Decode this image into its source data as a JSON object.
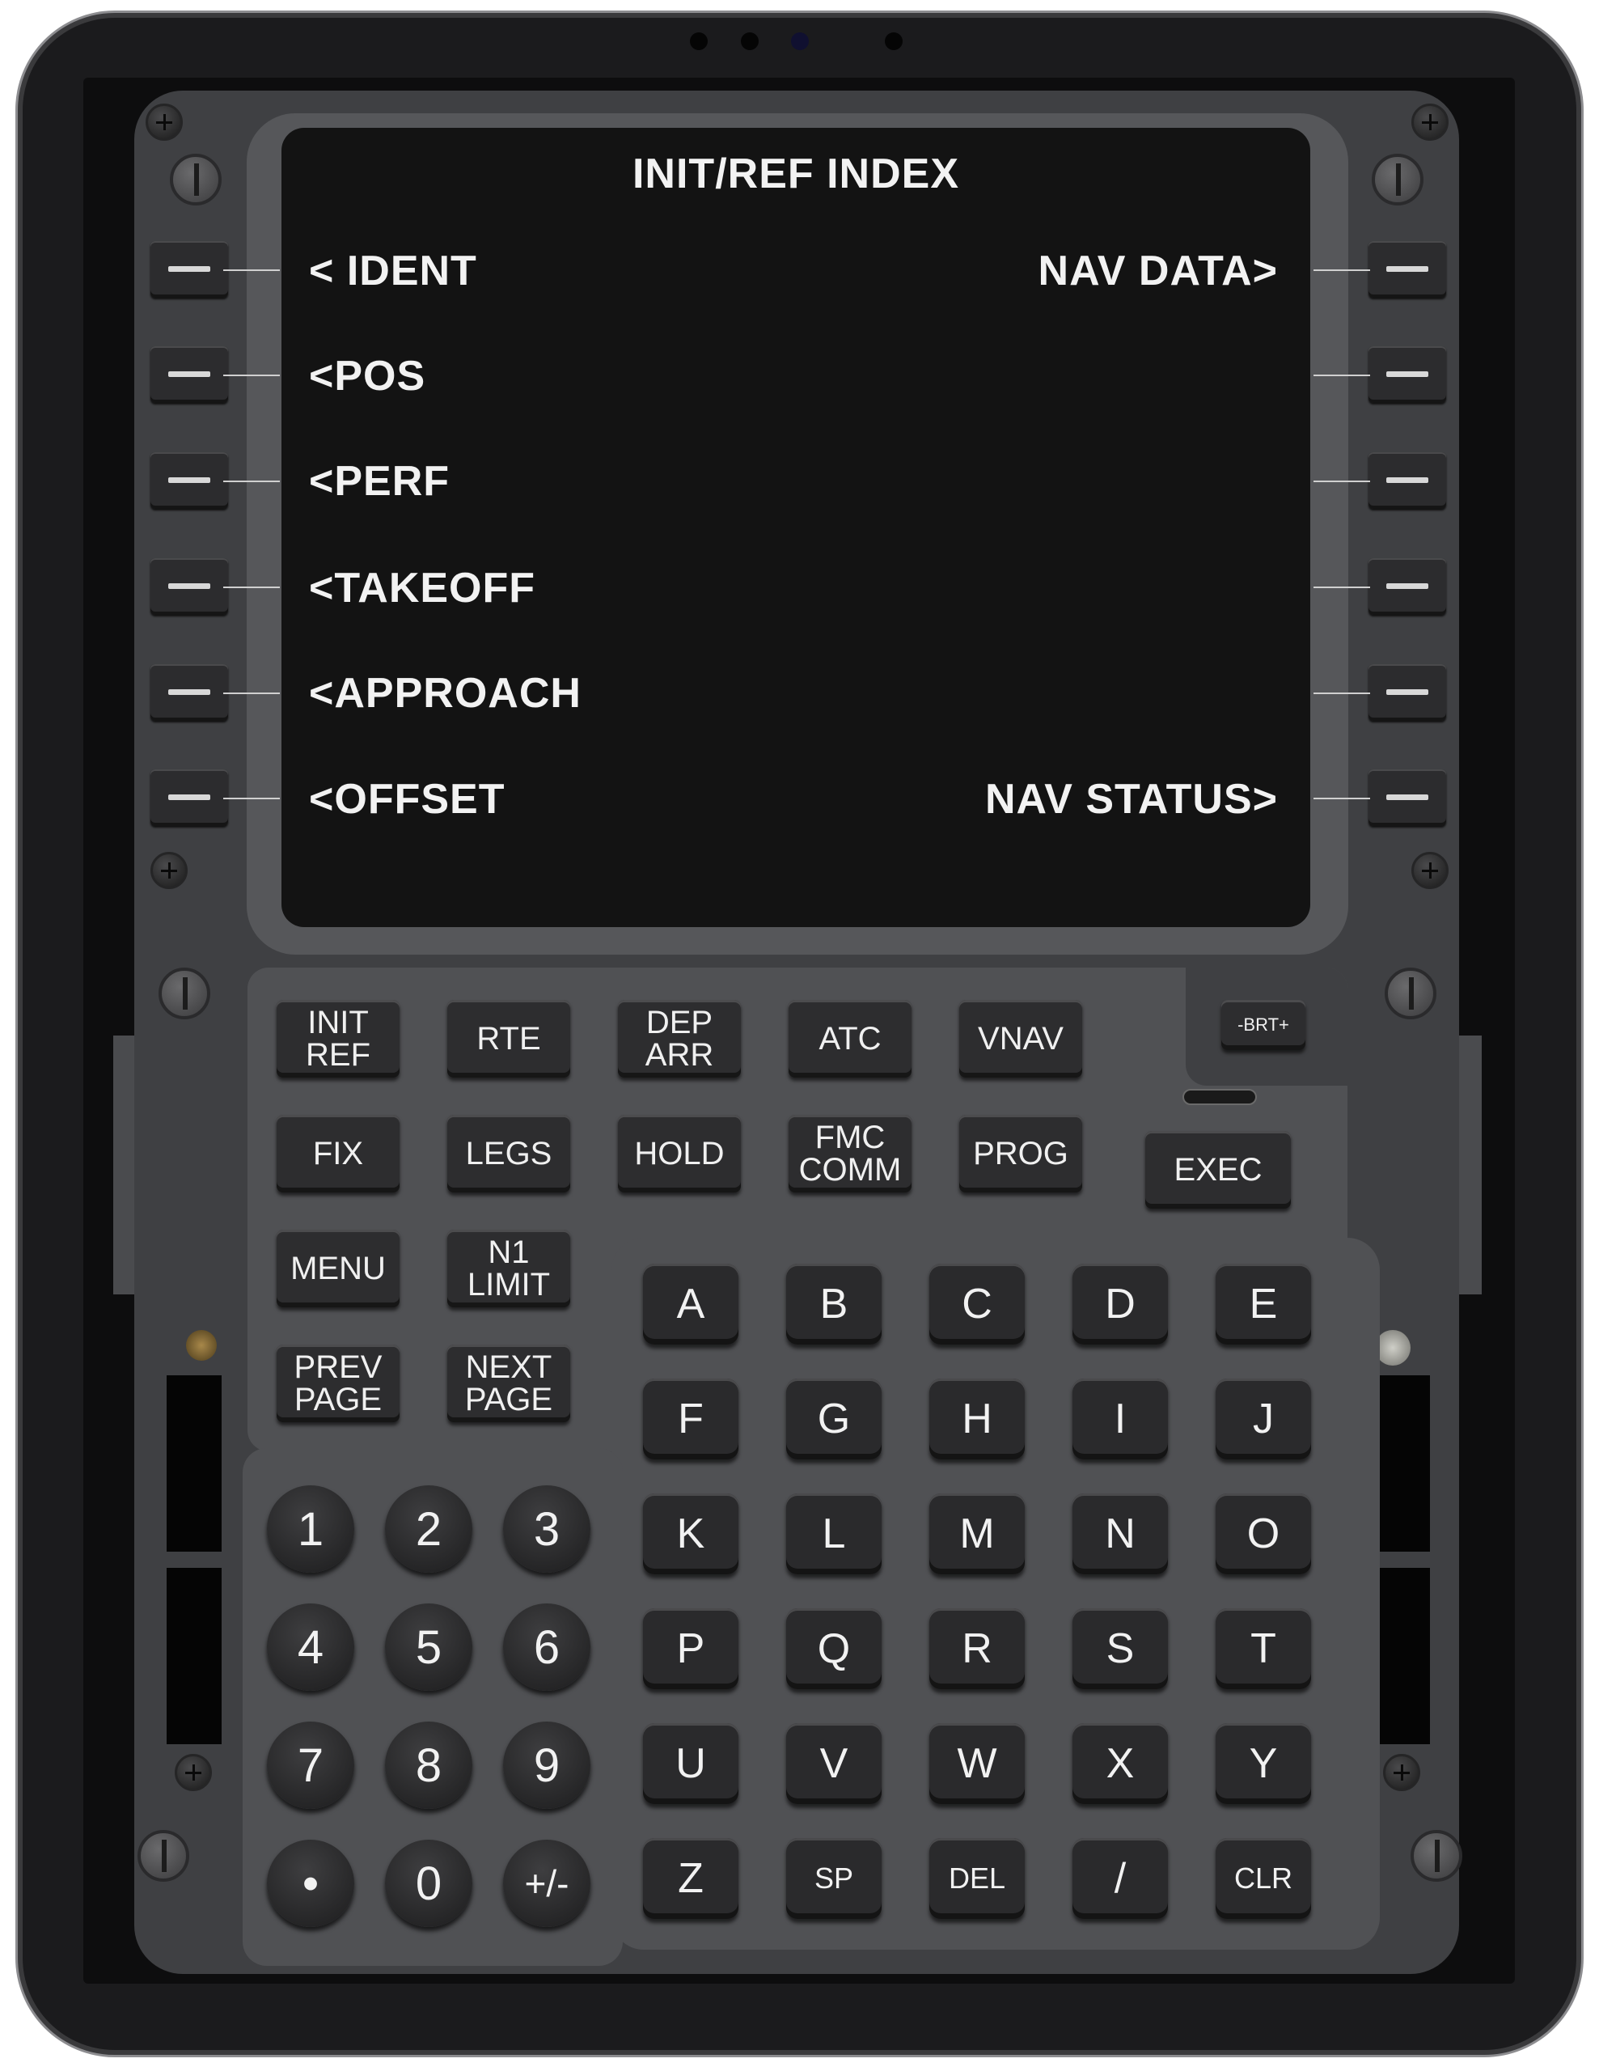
{
  "screen": {
    "title": "INIT/REF INDEX",
    "left": [
      "< IDENT",
      "<POS",
      "<PERF",
      "<TAKEOFF",
      "<APPROACH",
      "<OFFSET"
    ],
    "right": [
      "NAV DATA>",
      "",
      "",
      "",
      "",
      "NAV STATUS>"
    ]
  },
  "function_keys": {
    "init_ref": "INIT\nREF",
    "rte": "RTE",
    "dep_arr": "DEP\nARR",
    "atc": "ATC",
    "vnav": "VNAV",
    "fix": "FIX",
    "legs": "LEGS",
    "hold": "HOLD",
    "fmc_comm": "FMC\nCOMM",
    "prog": "PROG",
    "exec": "EXEC",
    "menu": "MENU",
    "n1_limit": "N1\nLIMIT",
    "prev_page": "PREV\nPAGE",
    "next_page": "NEXT\nPAGE",
    "brt": "-BRT+"
  },
  "alpha_keys": [
    "A",
    "B",
    "C",
    "D",
    "E",
    "F",
    "G",
    "H",
    "I",
    "J",
    "K",
    "L",
    "M",
    "N",
    "O",
    "P",
    "Q",
    "R",
    "S",
    "T",
    "U",
    "V",
    "W",
    "X",
    "Y",
    "Z",
    "SP",
    "DEL",
    "/",
    "CLR"
  ],
  "num_keys": [
    "1",
    "2",
    "3",
    "4",
    "5",
    "6",
    "7",
    "8",
    "9",
    "•",
    "0",
    "+/-"
  ],
  "colors": {
    "screen_bg": "#131313",
    "panel": "#3f4043",
    "key": "#2d2d2f",
    "text": "#f2f2f2"
  }
}
